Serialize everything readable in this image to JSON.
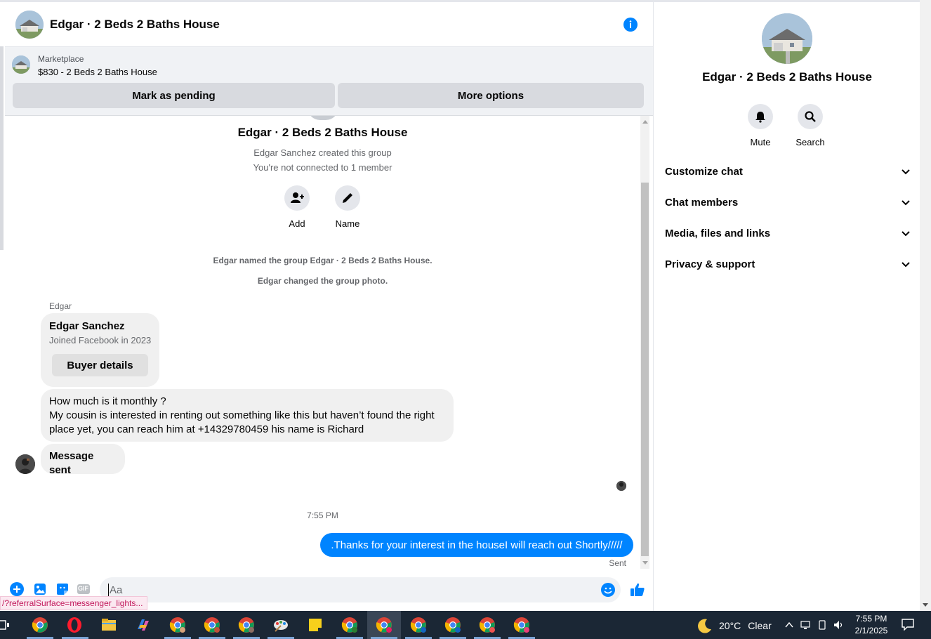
{
  "chat": {
    "title": "Edgar · 2 Beds 2 Baths House"
  },
  "marketplace": {
    "label": "Marketplace",
    "item": "$830 - 2 Beds 2 Baths House",
    "mark_pending": "Mark as pending",
    "more_options": "More options"
  },
  "group": {
    "title": "Edgar · 2 Beds 2 Baths House",
    "created": "Edgar Sanchez created this group",
    "connection": "You're not connected to 1 member",
    "add_label": "Add",
    "name_label": "Name"
  },
  "system": {
    "named": "Edgar named the group Edgar · 2 Beds 2 Baths House.",
    "photo": "Edgar changed the group photo."
  },
  "messages": {
    "sender": "Edgar",
    "card_name": "Edgar Sanchez",
    "card_joined": "Joined Facebook in 2023",
    "card_button": "Buyer details",
    "msg1_line1": "How much is it monthly ?",
    "msg1_line2": "My cousin is interested in renting out something like this but haven’t found the right",
    "msg1_line3": "place yet, you can reach him at +14329780459 his name is Richard",
    "msg2": "Message sent",
    "time": "7:55 PM",
    "outgoing": ".Thanks for your interest in the houseI will reach out Shortly/////",
    "status": "Sent"
  },
  "composer": {
    "placeholder": "Aa",
    "gif_label": "GIF"
  },
  "url_tooltip": "/?referralSurface=messenger_lights...",
  "panel": {
    "title": "Edgar · 2 Beds 2 Baths House",
    "mute": "Mute",
    "search": "Search",
    "sections": [
      "Customize chat",
      "Chat members",
      "Media, files and links",
      "Privacy & support"
    ]
  },
  "taskbar": {
    "temperature": "20°C",
    "condition": "Clear",
    "time": "7:55 PM",
    "date": "2/1/2025"
  },
  "colors": {
    "accent": "#0084ff",
    "bubble_gray": "#f0f0f0",
    "taskbar": "#1b2735"
  }
}
